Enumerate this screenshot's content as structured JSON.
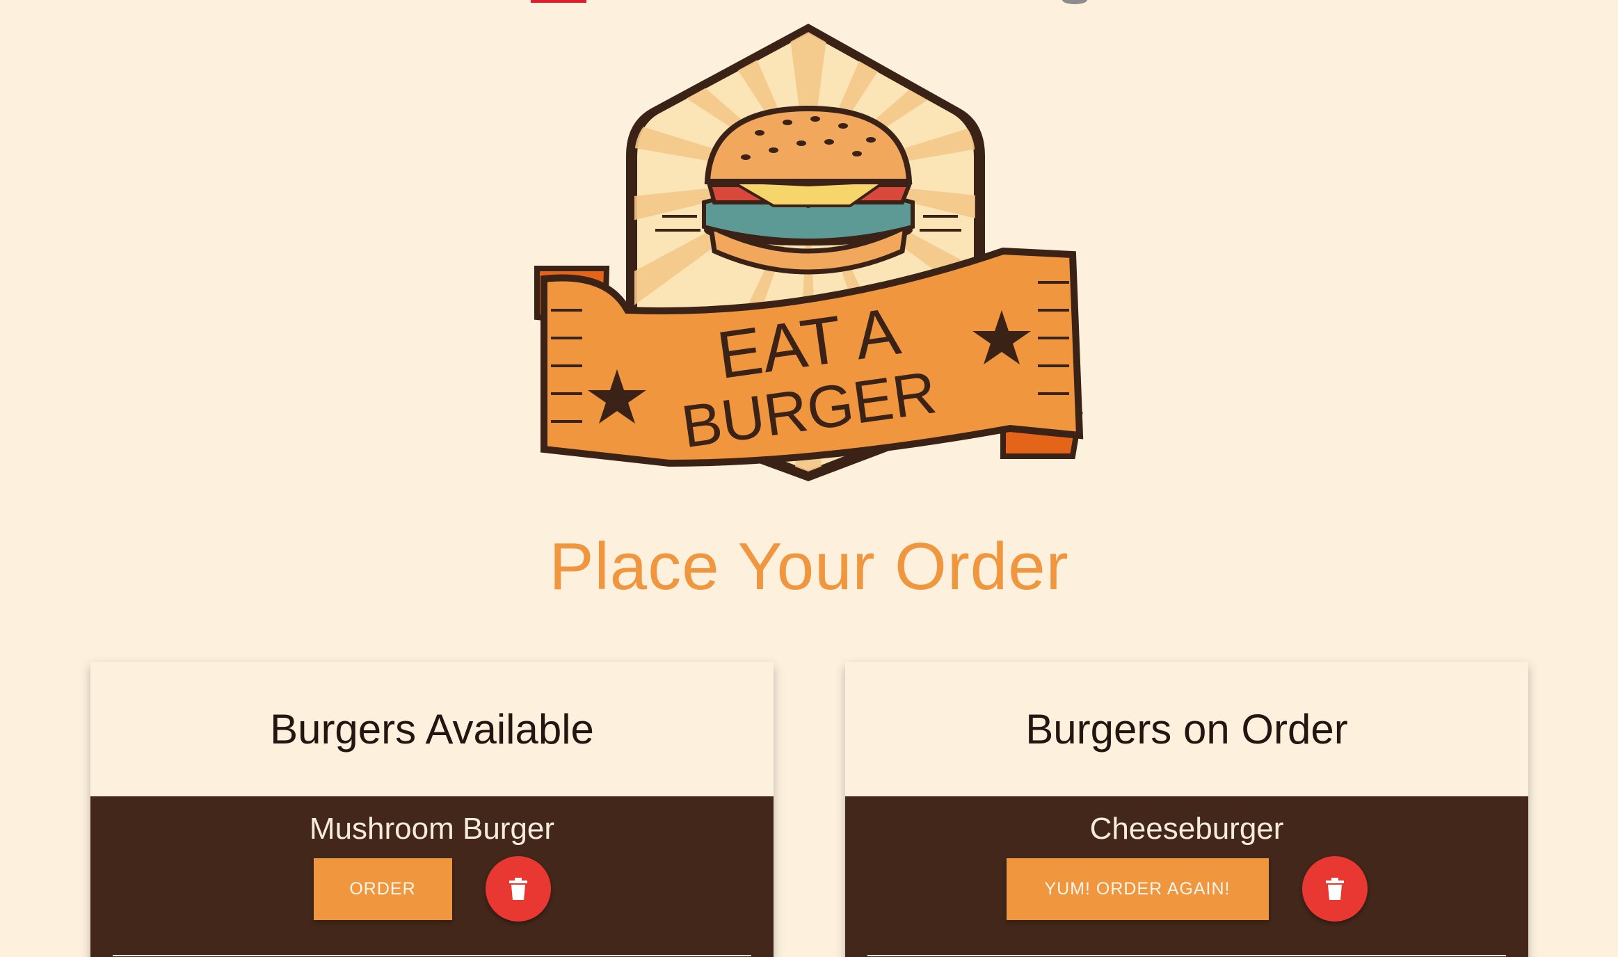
{
  "logo": {
    "line1": "EAT A",
    "line2": "BURGER"
  },
  "heading": "Place Your Order",
  "available": {
    "title": "Burgers Available",
    "item": {
      "name": "Mushroom Burger",
      "action_label": "ORDER",
      "delete_icon": "trash-icon"
    }
  },
  "on_order": {
    "title": "Burgers on Order",
    "item": {
      "name": "Cheeseburger",
      "action_label": "YUM! ORDER AGAIN!",
      "delete_icon": "trash-icon"
    }
  },
  "colors": {
    "background": "#fdf1de",
    "accent": "#f0963f",
    "panel": "#42271a",
    "delete": "#e93832"
  }
}
